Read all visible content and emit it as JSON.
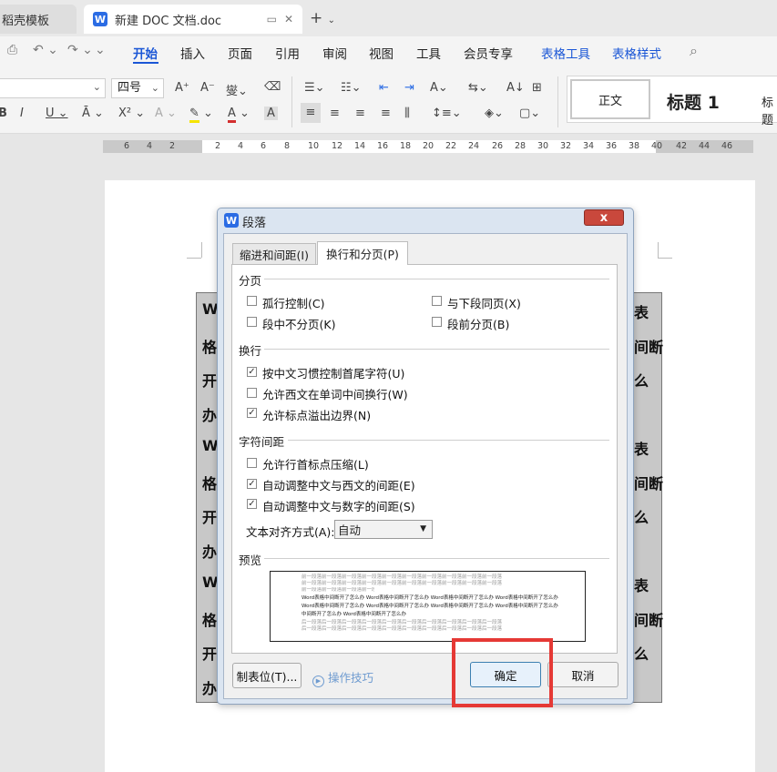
{
  "tabs": {
    "template": "稻壳模板",
    "doc": "新建 DOC 文档.doc"
  },
  "menu": [
    "开始",
    "插入",
    "页面",
    "引用",
    "审阅",
    "视图",
    "工具",
    "会员专享"
  ],
  "context_menu": [
    "表格工具",
    "表格样式"
  ],
  "ribbon": {
    "font_size": "四号",
    "styles": [
      "正文",
      "标题 1",
      "标题"
    ]
  },
  "ruler": [
    "6",
    "4",
    "2",
    "2",
    "4",
    "6",
    "8",
    "10",
    "12",
    "14",
    "16",
    "18",
    "20",
    "22",
    "24",
    "26",
    "28",
    "30",
    "32",
    "34",
    "36",
    "38",
    "40",
    "42",
    "44",
    "46"
  ],
  "page_text": {
    "left": [
      "W",
      "格",
      "开",
      "办",
      "W",
      "格",
      "开",
      "办",
      "W",
      "格",
      "开",
      "办"
    ],
    "right": [
      "表",
      "间断",
      "么",
      "",
      "表",
      "间断",
      "么",
      "",
      "表",
      "间断",
      "么",
      ""
    ]
  },
  "dialog": {
    "title": "段落",
    "close": "x",
    "tab_indent": "缩进和间距(I)",
    "tab_linebreak": "换行和分页(P)",
    "group_pagination": "分页",
    "widow_control": "孤行控制(C)",
    "keep_with_next": "与下段同页(X)",
    "keep_lines": "段中不分页(K)",
    "page_break_before": "段前分页(B)",
    "group_linebreak": "换行",
    "cn_rules": "按中文习惯控制首尾字符(U)",
    "word_wrap": "允许西文在单词中间换行(W)",
    "punct_overflow": "允许标点溢出边界(N)",
    "group_spacing": "字符间距",
    "compress_punct": "允许行首标点压缩(L)",
    "auto_space_cn_en": "自动调整中文与西文的间距(E)",
    "auto_space_cn_num": "自动调整中文与数字的间距(S)",
    "text_align_label": "文本对齐方式(A):",
    "text_align_value": "自动",
    "group_preview": "预览",
    "preview_prev": "前一段落前一段落前一段落前一段落前一段落前一段落前一段落前一段落前一段落前一段落",
    "preview_main1": "Word表格中间断开了怎么办 Word表格中间断开了怎么办 Word表格中间断开了怎么办 Word表格中间断开了怎么办",
    "preview_main2": "Word表格中间断开了怎么办 Word表格中间断开了怎么办 Word表格中间断开了怎么办 Word表格中间断开了怎么办",
    "preview_main3": "中间断开了怎么办 Word表格中间断开了怎么办",
    "preview_next": "后一段落后一段落后一段落后一段落后一段落后一段落后一段落后一段落后一段落后一段落",
    "btn_tabs": "制表位(T)...",
    "tips": "操作技巧",
    "btn_ok": "确定",
    "btn_cancel": "取消"
  },
  "colors": {
    "accent": "#1a56d6",
    "highlight": "#e53935"
  }
}
